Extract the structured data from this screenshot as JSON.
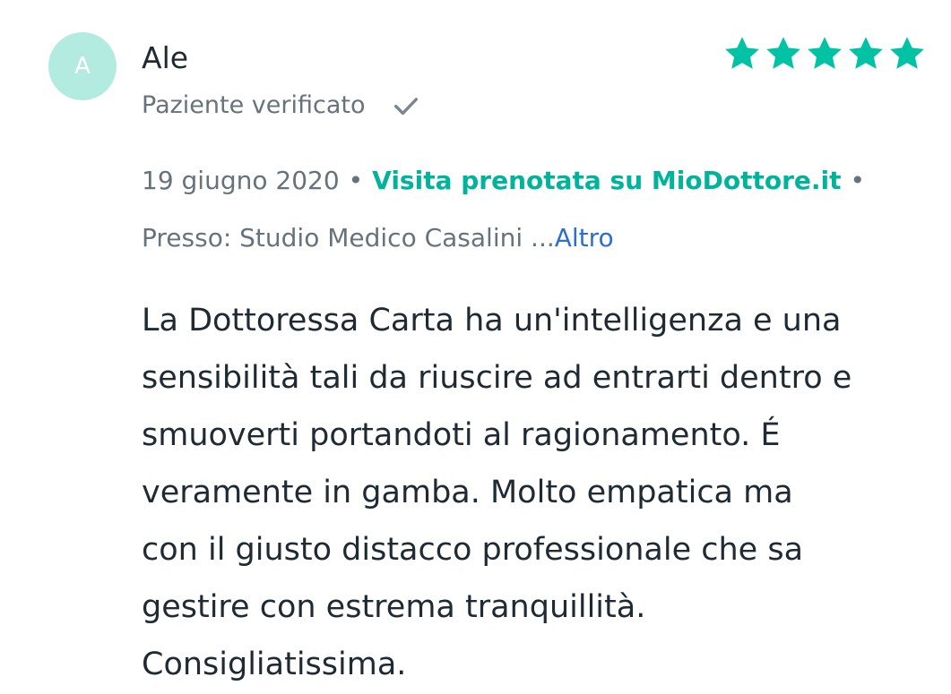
{
  "review": {
    "avatar_initial": "A",
    "author": "Ale",
    "rating": 5,
    "rating_max": 5,
    "star_color": "#00c3a5",
    "verified_label": "Paziente verificato",
    "date": "19 giugno 2020",
    "separator": "•",
    "booked_label": "Visita prenotata su MioDottore.it",
    "location_text": "Presso: Studio Medico Casalini ...",
    "more_label": "Altro",
    "text_lines": [
      "La Dottoressa Carta ha un'intelligenza e una",
      "sensibilità tali da riuscire ad entrarti dentro e",
      "smuoverti portandoti al ragionamento. É",
      "veramente in gamba. Molto empatica ma",
      "con il giusto distacco professionale che sa",
      "gestire con estrema tranquillità.",
      "Consigliatissima."
    ]
  }
}
